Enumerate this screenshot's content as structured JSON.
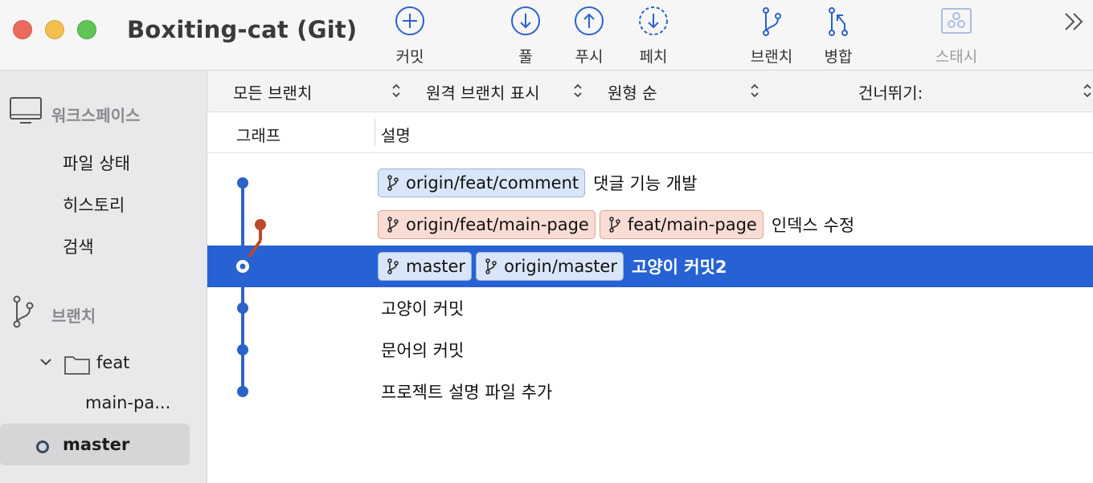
{
  "window": {
    "title": "Boxiting-cat (Git)"
  },
  "toolbar": {
    "commit": "커밋",
    "pull": "풀",
    "push": "푸시",
    "fetch": "페치",
    "branch": "브랜치",
    "merge": "병합",
    "stash": "스태시"
  },
  "sidebar": {
    "workspace_header": "워크스페이스",
    "workspace_items": [
      "파일 상태",
      "히스토리",
      "검색"
    ],
    "branches_header": "브랜치",
    "folder": "feat",
    "folder_child": "main-pa...",
    "current_branch": "master"
  },
  "filters": {
    "branches": "모든 브랜치",
    "remote": "원격 브랜치 표시",
    "order": "원형 순",
    "skip": "건너뛰기:"
  },
  "columns": {
    "graph": "그래프",
    "description": "설명"
  },
  "commits": [
    {
      "tags": [
        {
          "name": "origin/feat/comment",
          "kind": "remote"
        }
      ],
      "message": "댓글 기능 개발"
    },
    {
      "tags": [
        {
          "name": "origin/feat/main-page",
          "kind": "local"
        },
        {
          "name": "feat/main-page",
          "kind": "local"
        }
      ],
      "message": "인덱스 수정"
    },
    {
      "tags": [
        {
          "name": "master",
          "kind": "remote"
        },
        {
          "name": "origin/master",
          "kind": "remote"
        }
      ],
      "message": "고양이 커밋2",
      "selected": true
    },
    {
      "tags": [],
      "message": "고양이 커밋"
    },
    {
      "tags": [],
      "message": "문어의 커밋"
    },
    {
      "tags": [],
      "message": "프로젝트 설명 파일 추가"
    }
  ],
  "colors": {
    "accent": "#2762d5",
    "graph_main": "#2b63c9",
    "graph_branch": "#b94a2a",
    "remote_tag_bg": "#d9e5f8",
    "local_tag_bg": "#f9ddd4"
  }
}
